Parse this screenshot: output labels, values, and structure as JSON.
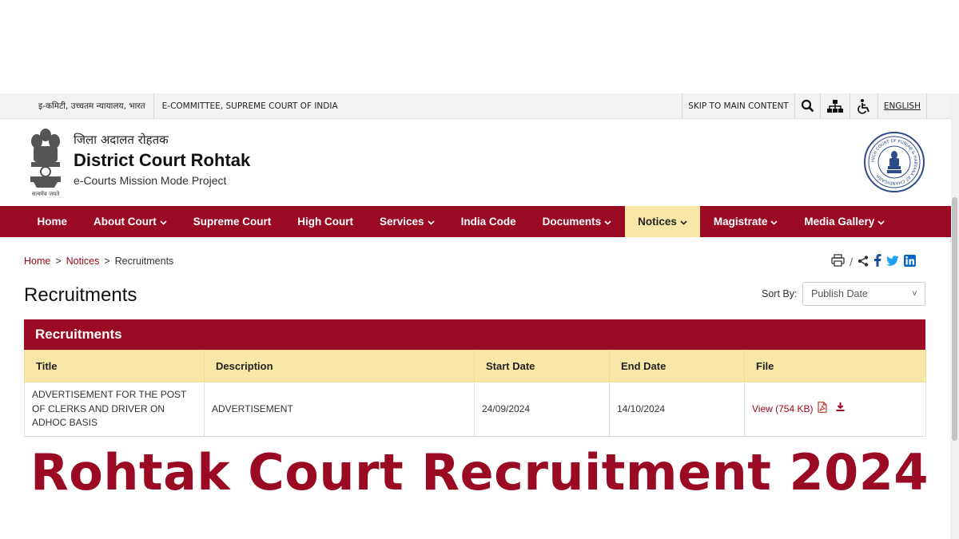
{
  "colors": {
    "brand": "#9b0a23",
    "highlight": "#f8e7a6",
    "topbar": "#f2f2f2"
  },
  "topbar": {
    "hindi_label": "इ-कमिटी, उच्चतम न्यायालय, भारत",
    "committee_label": "E-COMMITTEE, SUPREME COURT OF INDIA",
    "skip_label": "SKIP TO MAIN CONTENT",
    "icons": [
      "search-icon",
      "sitemap-icon",
      "accessibility-icon"
    ],
    "language_label": "ENGLISH"
  },
  "header": {
    "title_hindi": "जिला अदालत रोहतक",
    "title": "District Court Rohtak",
    "subtitle": "e-Courts Mission Mode Project",
    "emblem_motto": "सत्यमेव जयते",
    "seal_text": "HIGH COURT OF PUNJAB & HARYANA AT CHANDIGARH"
  },
  "nav": {
    "items": [
      {
        "label": "Home",
        "dropdown": false,
        "active": false
      },
      {
        "label": "About Court",
        "dropdown": true,
        "active": false
      },
      {
        "label": "Supreme Court",
        "dropdown": false,
        "active": false
      },
      {
        "label": "High Court",
        "dropdown": false,
        "active": false
      },
      {
        "label": "Services",
        "dropdown": true,
        "active": false
      },
      {
        "label": "India Code",
        "dropdown": false,
        "active": false
      },
      {
        "label": "Documents",
        "dropdown": true,
        "active": false
      },
      {
        "label": "Notices",
        "dropdown": true,
        "active": true
      },
      {
        "label": "Magistrate",
        "dropdown": true,
        "active": false
      },
      {
        "label": "Media Gallery",
        "dropdown": true,
        "active": false
      }
    ]
  },
  "breadcrumb": {
    "items": [
      "Home",
      "Notices",
      "Recruitments"
    ],
    "separator": ">"
  },
  "share": {
    "separator": "/",
    "icons": [
      "print-icon",
      "share-icon",
      "facebook-icon",
      "twitter-icon",
      "linkedin-icon"
    ]
  },
  "page": {
    "title": "Recruitments",
    "sort_label": "Sort By:",
    "sort_value": "Publish Date"
  },
  "recruitments": {
    "panel_title": "Recruitments",
    "columns": [
      "Title",
      "Description",
      "Start Date",
      "End Date",
      "File"
    ],
    "rows": [
      {
        "title": "ADVERTISEMENT FOR THE POST OF CLERKS AND DRIVER ON ADHOC BASIS",
        "description": "ADVERTISEMENT",
        "start_date": "24/09/2024",
        "end_date": "14/10/2024",
        "file_label": "View (754 KB)"
      }
    ]
  },
  "banner": {
    "text": "Rohtak Court Recruitment 2024"
  }
}
